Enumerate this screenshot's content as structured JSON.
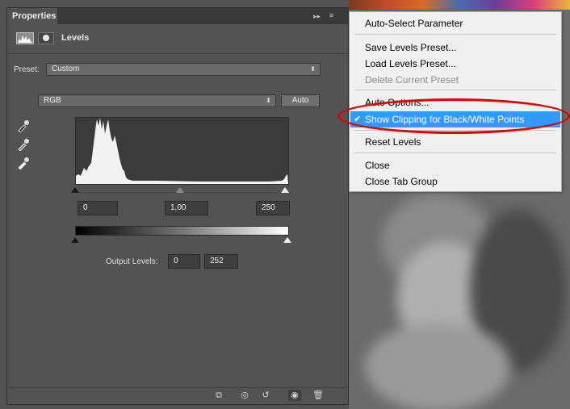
{
  "panel": {
    "tab_label": "Properties",
    "tab_close": "▸▸",
    "menu_icon": "≡",
    "title": "Levels",
    "preset_label": "Preset:",
    "preset_value": "Custom",
    "channel_value": "RGB",
    "auto_label": "Auto",
    "input_black": "0",
    "input_gamma": "1,00",
    "input_white": "250",
    "output_label": "Output Levels:",
    "output_black": "0",
    "output_white": "252"
  },
  "bottom_bar": {
    "icons": [
      "clip-to-layer-icon",
      "view-previous-icon",
      "reset-icon",
      "visibility-eye-icon",
      "trash-icon"
    ]
  },
  "context_menu": {
    "items": [
      {
        "label": "Auto-Select Parameter",
        "state": "normal"
      },
      {
        "label": "Save Levels Preset...",
        "state": "normal"
      },
      {
        "label": "Load Levels Preset...",
        "state": "normal"
      },
      {
        "label": "Delete Current Preset",
        "state": "disabled"
      },
      {
        "label": "Auto Options...",
        "state": "normal"
      },
      {
        "label": "Show Clipping for Black/White Points",
        "state": "selected",
        "checked": true
      },
      {
        "label": "Reset Levels",
        "state": "normal"
      },
      {
        "label": "Close",
        "state": "normal"
      },
      {
        "label": "Close Tab Group",
        "state": "normal"
      }
    ],
    "check_mark": "✔",
    "highlight_color": "#e00000",
    "selected_color": "#3399ff"
  }
}
